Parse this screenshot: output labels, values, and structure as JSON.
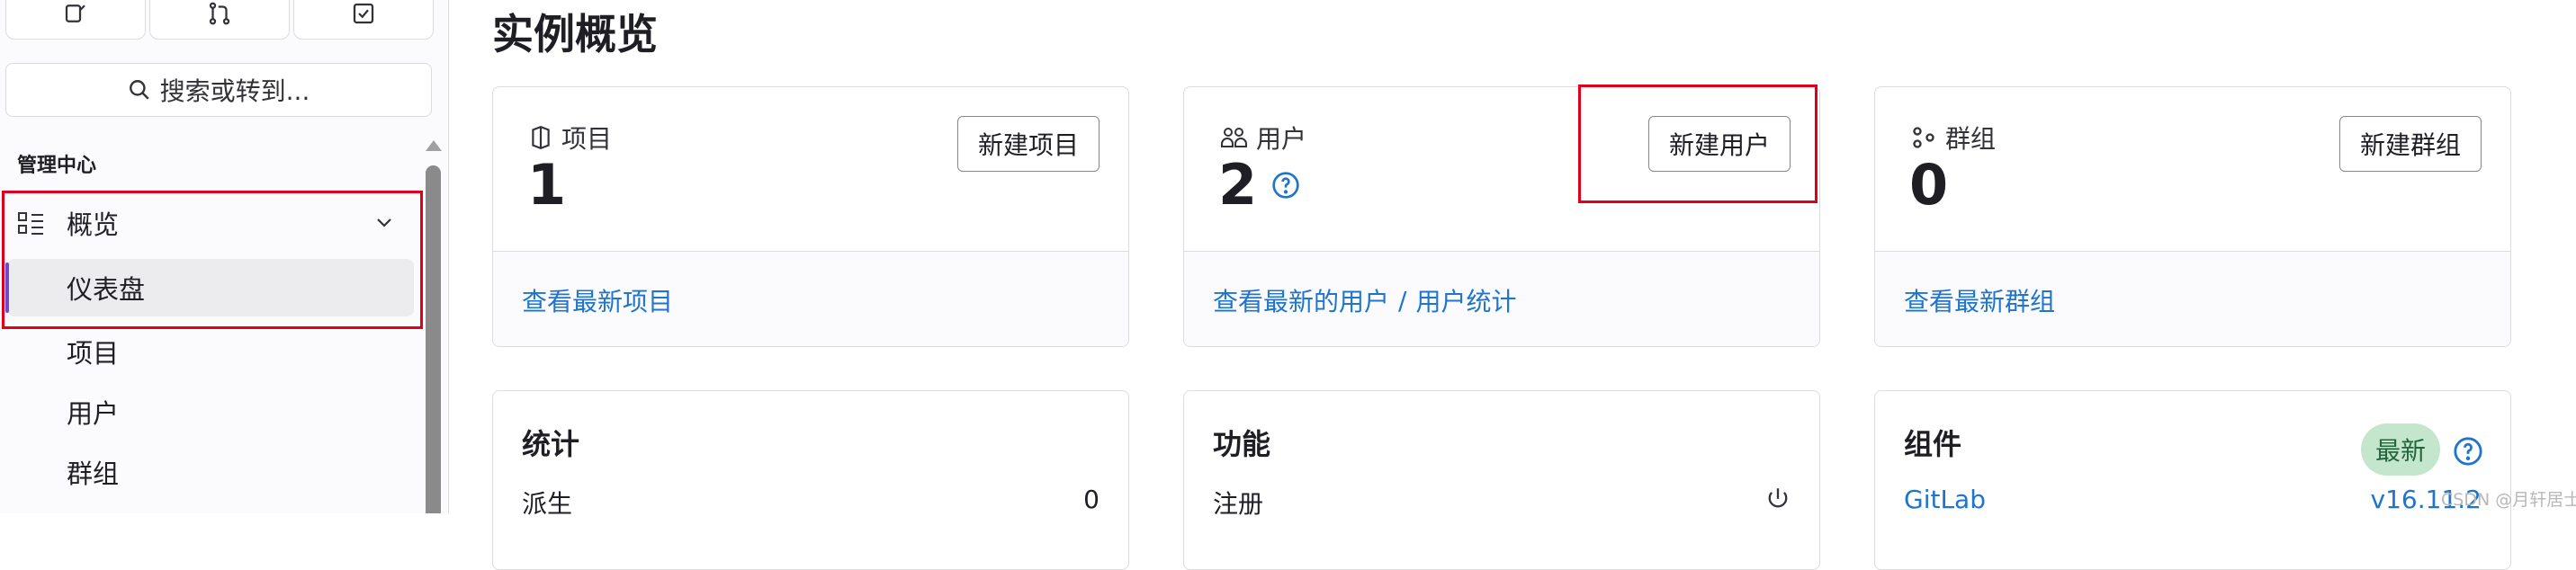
{
  "sidebar": {
    "search_label": "搜索或转到...",
    "section_title": "管理中心",
    "overview_label": "概览",
    "active_item": "仪表盘",
    "items": [
      "项目",
      "用户",
      "群组"
    ]
  },
  "main": {
    "title": "实例概览",
    "cards": {
      "projects": {
        "label": "项目",
        "count": "1",
        "button": "新建项目",
        "footer_link": "查看最新项目"
      },
      "users": {
        "label": "用户",
        "count": "2",
        "button": "新建用户",
        "footer_link_1": "查看最新的用户",
        "footer_sep": "/",
        "footer_link_2": "用户统计"
      },
      "groups": {
        "label": "群组",
        "count": "0",
        "button": "新建群组",
        "footer_link": "查看最新群组"
      }
    },
    "statistics": {
      "title": "统计",
      "row_label": "派生",
      "row_value": "0"
    },
    "features": {
      "title": "功能",
      "row_label": "注册"
    },
    "components": {
      "title": "组件",
      "badge": "最新",
      "row_label": "GitLab",
      "row_value": "v16.11.2"
    }
  },
  "watermark": "CSDN @月轩居士",
  "colors": {
    "accent_link": "#1f75cb",
    "highlight_red": "#e0001b",
    "badge_green_bg": "#c3e6cd",
    "active_bar": "#6e49cb"
  },
  "icons": [
    "pencil-square-icon",
    "merge-request-icon",
    "todo-check-icon",
    "search-icon",
    "grid-list-icon",
    "chevron-down-icon",
    "project-icon",
    "users-icon",
    "groups-icon",
    "question-circle-icon",
    "power-icon"
  ]
}
